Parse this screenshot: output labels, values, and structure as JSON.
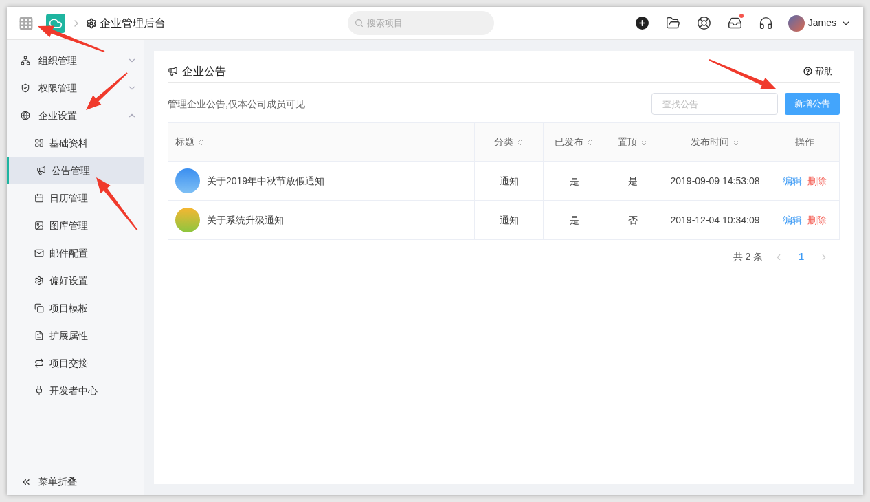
{
  "header": {
    "title": "企业管理后台",
    "search": {
      "placeholder": "搜索项目"
    },
    "inbox_unread": true,
    "user": {
      "name": "James"
    }
  },
  "sidebar": {
    "items": [
      {
        "label": "组织管理",
        "expanded": false
      },
      {
        "label": "权限管理",
        "expanded": false
      },
      {
        "label": "企业设置",
        "expanded": true,
        "children": [
          {
            "label": "基础资料",
            "selected": false
          },
          {
            "label": "公告管理",
            "selected": true
          },
          {
            "label": "日历管理",
            "selected": false
          },
          {
            "label": "图库管理",
            "selected": false
          },
          {
            "label": "邮件配置",
            "selected": false
          },
          {
            "label": "偏好设置",
            "selected": false
          },
          {
            "label": "项目模板",
            "selected": false
          },
          {
            "label": "扩展属性",
            "selected": false
          },
          {
            "label": "项目交接",
            "selected": false
          },
          {
            "label": "开发者中心",
            "selected": false
          }
        ]
      }
    ],
    "collapse": "菜单折叠"
  },
  "page": {
    "title": "企业公告",
    "help": "帮助",
    "description": "管理企业公告,仅本公司成员可见",
    "search": {
      "placeholder": "查找公告"
    },
    "add_button": "新增公告"
  },
  "table": {
    "columns": [
      {
        "label": "标题",
        "sortable": true
      },
      {
        "label": "分类",
        "sortable": true
      },
      {
        "label": "已发布",
        "sortable": true
      },
      {
        "label": "置顶",
        "sortable": true
      },
      {
        "label": "发布时间",
        "sortable": true
      },
      {
        "label": "操作",
        "sortable": false
      }
    ],
    "rows": [
      {
        "title": "关于2019年中秋节放假通知",
        "category": "通知",
        "published": "是",
        "pinned": "是",
        "time": "2019-09-09 14:53:08",
        "actions": [
          "编辑",
          "删除"
        ]
      },
      {
        "title": "关于系统升级通知",
        "category": "通知",
        "published": "是",
        "pinned": "否",
        "time": "2019-12-04 10:34:09",
        "actions": [
          "编辑",
          "删除"
        ]
      }
    ]
  },
  "pagination": {
    "total": "共 2 条",
    "pages": [
      {
        "label": "1",
        "selected": true
      }
    ]
  }
}
